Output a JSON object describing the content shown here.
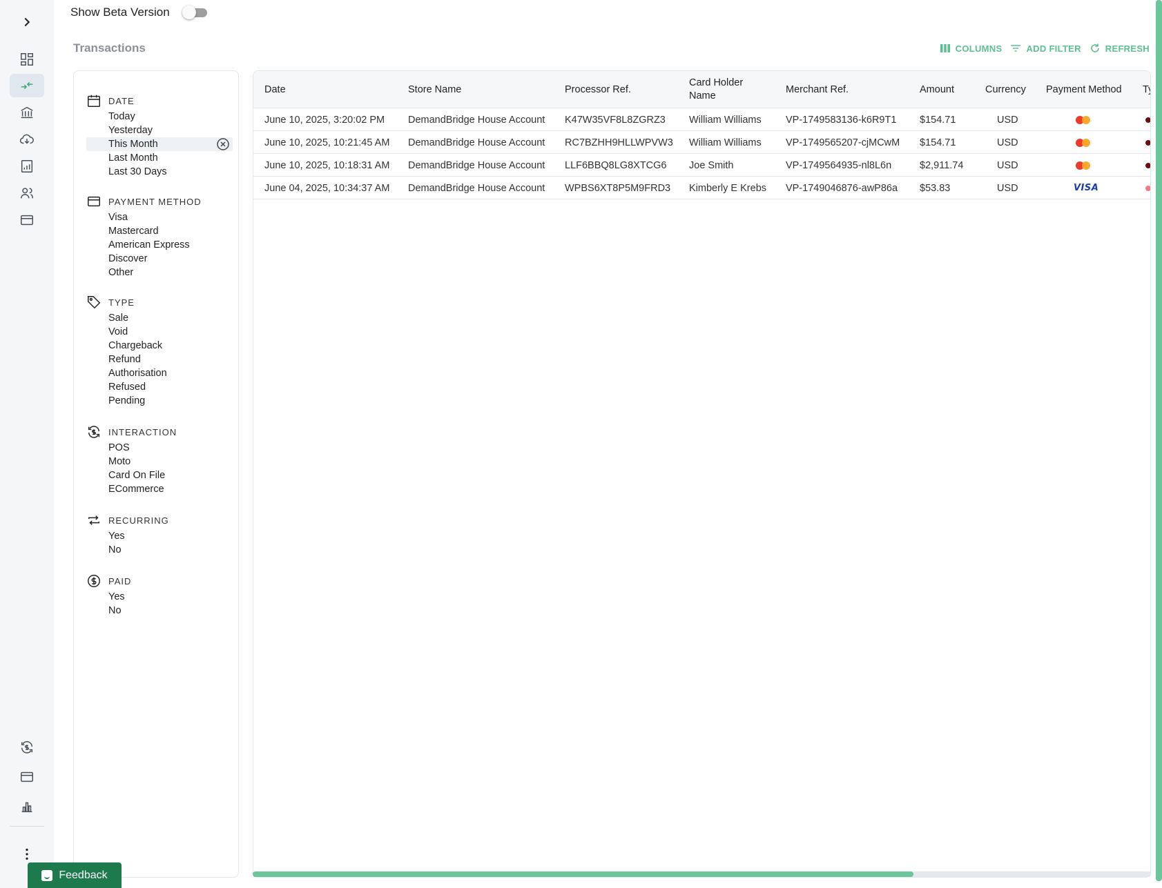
{
  "beta": {
    "label": "Show Beta Version",
    "enabled": false
  },
  "page": {
    "title": "Transactions"
  },
  "toolbar": {
    "columns": "COLUMNS",
    "add_filter": "ADD FILTER",
    "refresh": "REFRESH"
  },
  "colors": {
    "accent": "#5bbf91",
    "feedback_bg": "#1d7a4c",
    "mastercard_red": "#eb3b2b",
    "mastercard_orange": "#f7a21b",
    "visa_blue": "#1a3ea8"
  },
  "rail": {
    "items": [
      {
        "icon": "chevron-right-icon"
      },
      {
        "icon": "dashboard-icon"
      },
      {
        "icon": "transactions-icon",
        "active": true
      },
      {
        "icon": "bank-icon"
      },
      {
        "icon": "cloud-download-icon"
      },
      {
        "icon": "reports-icon"
      },
      {
        "icon": "users-icon"
      },
      {
        "icon": "card-icon"
      },
      {
        "icon": "sync-icon"
      },
      {
        "icon": "card-icon"
      },
      {
        "icon": "bar-chart-icon"
      },
      {
        "icon": "more-vertical-icon"
      }
    ]
  },
  "filters": {
    "date": {
      "title": "DATE",
      "icon": "calendar-icon",
      "items": [
        "Today",
        "Yesterday",
        "This Month",
        "Last Month",
        "Last 30 Days"
      ],
      "selected": "This Month"
    },
    "payment_method": {
      "title": "PAYMENT METHOD",
      "icon": "card-icon",
      "items": [
        "Visa",
        "Mastercard",
        "American Express",
        "Discover",
        "Other"
      ]
    },
    "type": {
      "title": "TYPE",
      "icon": "tag-icon",
      "items": [
        "Sale",
        "Void",
        "Chargeback",
        "Refund",
        "Authorisation",
        "Refused",
        "Pending"
      ]
    },
    "interaction": {
      "title": "INTERACTION",
      "icon": "sync-dollar-icon",
      "items": [
        "POS",
        "Moto",
        "Card On File",
        "ECommerce"
      ]
    },
    "recurring": {
      "title": "RECURRING",
      "icon": "repeat-icon",
      "items": [
        "Yes",
        "No"
      ]
    },
    "paid": {
      "title": "PAID",
      "icon": "dollar-circle-icon",
      "items": [
        "Yes",
        "No"
      ]
    }
  },
  "table": {
    "columns": [
      "Date",
      "Store Name",
      "Processor Ref.",
      "Card Holder Name",
      "Merchant Ref.",
      "Amount",
      "Currency",
      "Payment Method",
      "Ty"
    ],
    "rows": [
      {
        "date": "June 10, 2025, 3:20:02 PM",
        "store": "DemandBridge House Account",
        "processor_ref": "K47W35VF8L8ZGRZ3",
        "holder": "William Williams",
        "merchant_ref": "VP-1749583136-k6R9T1",
        "amount": "$154.71",
        "currency": "USD",
        "method": "mastercard",
        "type_color": "#6b0f14"
      },
      {
        "date": "June 10, 2025, 10:21:45 AM",
        "store": "DemandBridge House Account",
        "processor_ref": "RC7BZHH9HLLWPVW3",
        "holder": "William Williams",
        "merchant_ref": "VP-1749565207-cjMCwM",
        "amount": "$154.71",
        "currency": "USD",
        "method": "mastercard",
        "type_color": "#6b0f14"
      },
      {
        "date": "June 10, 2025, 10:18:31 AM",
        "store": "DemandBridge House Account",
        "processor_ref": "LLF6BBQ8LG8XTCG6",
        "holder": "Joe Smith",
        "merchant_ref": "VP-1749564935-nl8L6n",
        "amount": "$2,911.74",
        "currency": "USD",
        "method": "mastercard",
        "type_color": "#6b0f14"
      },
      {
        "date": "June 04, 2025, 10:34:37 AM",
        "store": "DemandBridge House Account",
        "processor_ref": "WPBS6XT8P5M9FRD3",
        "holder": "Kimberly E Krebs",
        "merchant_ref": "VP-1749046876-awP86a",
        "amount": "$53.83",
        "currency": "USD",
        "method": "visa",
        "method_label": "VISA",
        "type_color": "#f07b86"
      }
    ]
  },
  "feedback": {
    "label": "Feedback"
  }
}
